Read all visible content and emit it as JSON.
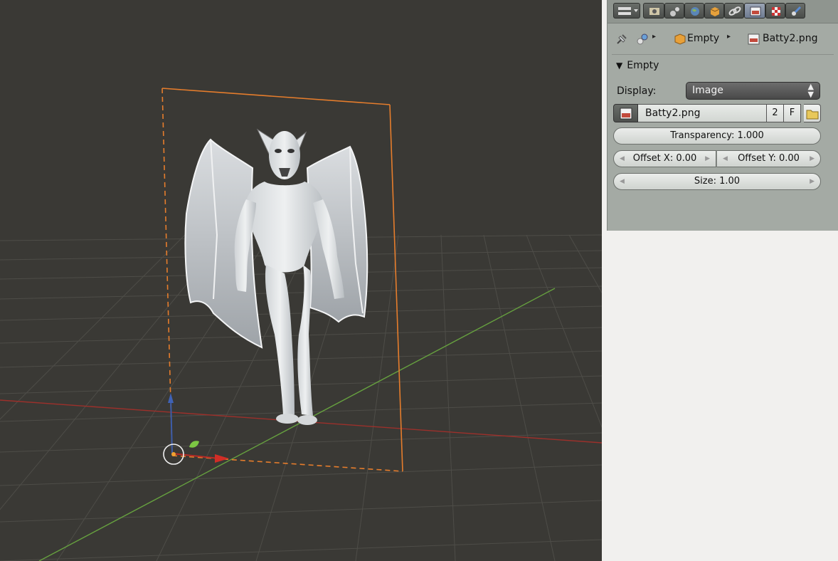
{
  "panel": {
    "tabs": [
      {
        "icon": "editor-type-icon",
        "active": false
      },
      {
        "icon": "render-icon",
        "active": false
      },
      {
        "icon": "scene-icon",
        "active": false
      },
      {
        "icon": "world-icon",
        "active": false
      },
      {
        "icon": "object-icon",
        "active": false
      },
      {
        "icon": "constraints-icon",
        "active": false
      },
      {
        "icon": "object-data-image-icon",
        "active": true
      },
      {
        "icon": "texture-icon",
        "active": false
      },
      {
        "icon": "physics-icon",
        "active": false
      }
    ],
    "breadcrumb": {
      "pin_icon": "pin-icon",
      "scene_icon": "scene-icon",
      "object_label": "Empty",
      "image_label": "Batty2.png"
    },
    "section": {
      "title": "Empty",
      "display_label": "Display:",
      "display_value": "Image",
      "image_name": "Batty2.png",
      "users_count": "2",
      "fake_user": "F",
      "transparency": "Transparency: 1.000",
      "offset_x": "Offset X: 0.00",
      "offset_y": "Offset Y: 0.00",
      "size": "Size: 1.00"
    }
  },
  "colors": {
    "viewport_bg": "#3a3935",
    "grid": "#4c4b46",
    "x_axis": "#a0312c",
    "y_axis": "#6aa043",
    "selection_outline": "#e87b28",
    "panel_bg": "#a4aaa4"
  }
}
